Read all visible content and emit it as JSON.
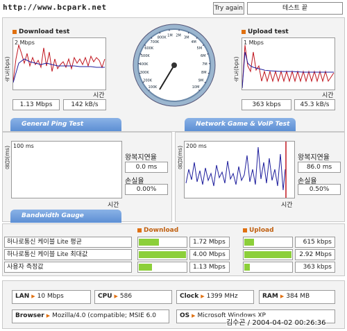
{
  "header": {
    "url": "http://www.bcpark.net",
    "try_again": "Try again",
    "end_test": "테스트 끝"
  },
  "download": {
    "title": "Download test",
    "ylabel": "속도(bps)",
    "scale": "2 Mbps",
    "xlabel": "시간",
    "mbps": "1.13 Mbps",
    "kbs": "142 kB/s"
  },
  "upload": {
    "title": "Upload test",
    "ylabel": "속도(bps)",
    "scale": "1 Mbps",
    "xlabel": "시간",
    "kbps": "363 kbps",
    "kbs": "45.3 kB/s"
  },
  "gauge": {
    "ticks": [
      "100K",
      "200K",
      "300K",
      "400K",
      "500K",
      "600K",
      "700K",
      "800K",
      "1M",
      "2M",
      "3M",
      "4M",
      "5M",
      "6M",
      "7M",
      "8M",
      "9M",
      "10M"
    ]
  },
  "tabs": {
    "ping": "General Ping Test",
    "game": "Network Game & VoIP Test",
    "bandwidth": "Bandwidth Gauge"
  },
  "ping": {
    "ylabel": "응답(ms)",
    "scale": "100 ms",
    "xlabel": "시간",
    "rtt_label": "왕복지연율",
    "rtt": "0.0 ms",
    "loss_label": "손실율",
    "loss": "0.00%"
  },
  "game": {
    "ylabel": "응답(ms)",
    "scale": "200 ms",
    "xlabel": "시간",
    "rtt_label": "왕복지연율",
    "rtt": "86.0 ms",
    "loss_label": "손실율",
    "loss": "0.50%"
  },
  "bandwidth": {
    "download_header": "Download",
    "upload_header": "Upload",
    "rows": [
      {
        "label": "하나로통신 케이블 Lite 평균",
        "down": "1.72 Mbps",
        "down_pct": 0.43,
        "up": "615 kbps",
        "up_pct": 0.21
      },
      {
        "label": "하나로통신 케이블 Lite 최대값",
        "down": "4.00 Mbps",
        "down_pct": 1.0,
        "up": "2.92 Mbps",
        "up_pct": 1.0
      },
      {
        "label": "사용자 측정값",
        "down": "1.13 Mbps",
        "down_pct": 0.28,
        "up": "363 kbps",
        "up_pct": 0.12
      }
    ]
  },
  "system": {
    "lan_label": "LAN",
    "lan": "10 Mbps",
    "cpu_label": "CPU",
    "cpu": "586",
    "clock_label": "Clock",
    "clock": "1399 MHz",
    "ram_label": "RAM",
    "ram": "384 MB",
    "browser_label": "Browser",
    "browser": "Mozilla/4.0 (compatible; MSIE 6.0",
    "os_label": "OS",
    "os": "Microsoft Windows XP"
  },
  "footer": {
    "stamp": "김수곤 / 2004-04-02 00:26:36"
  },
  "colors": {
    "accent": "#e07010",
    "bar": "#8ccf3a",
    "tab": "#5d8fd4",
    "red_line": "#c0151e",
    "blue_line": "#1c1c9c"
  }
}
